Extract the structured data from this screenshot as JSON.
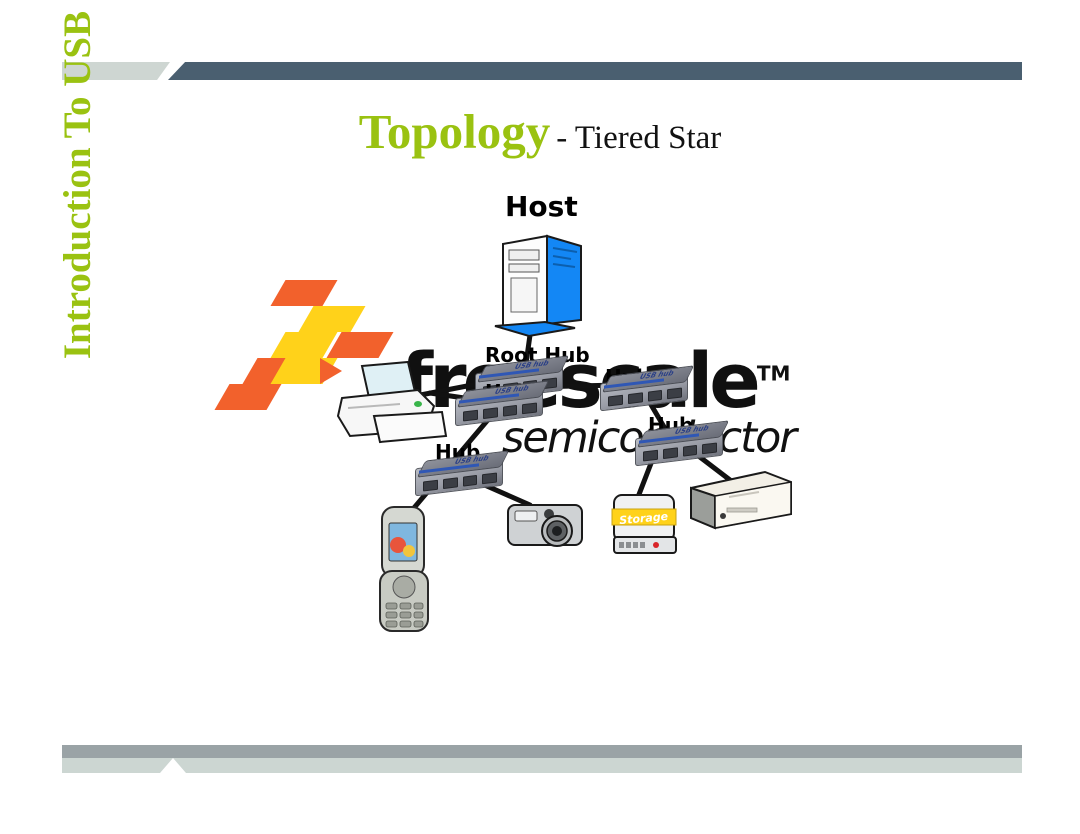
{
  "slide": {
    "title_main": "Topology",
    "title_sub": "- Tiered Star",
    "sidebar_label": "Introduction To USB"
  },
  "theme": {
    "accent_green": "#9ac211",
    "bar_dark": "#4a5f70",
    "bar_light": "#ced6d2",
    "footer_dark": "#9aa3a6",
    "footer_light": "#ccd6d2",
    "title_black": "#121212",
    "logo_orange": "#f2612c",
    "logo_yellow": "#ffd21a"
  },
  "watermark": {
    "wordmark": "freescale",
    "trademark": "TM",
    "tagline": "semiconductor"
  },
  "diagram": {
    "type": "tiered-star-topology",
    "labels": {
      "host": "Host",
      "root_hub": "Root Hub",
      "hub_a": "Hub",
      "hub_b": "Hub",
      "hub_c": "Hub",
      "hub_d": "Hub"
    },
    "devices": [
      {
        "name": "host-pc",
        "label": "Host",
        "tier": 0
      },
      {
        "name": "root-hub",
        "label": "Root Hub",
        "tier": 1
      },
      {
        "name": "hub-left",
        "label": "Hub",
        "tier": 2
      },
      {
        "name": "hub-mid",
        "label": "Hub",
        "tier": 2
      },
      {
        "name": "hub-right",
        "label": "Hub",
        "tier": 3
      },
      {
        "name": "hub-low",
        "label": "Hub",
        "tier": 3
      },
      {
        "name": "printer",
        "label": "",
        "tier": 3
      },
      {
        "name": "mobile-phone",
        "label": "",
        "tier": 4
      },
      {
        "name": "digital-camera",
        "label": "",
        "tier": 4
      },
      {
        "name": "storage-drive",
        "label": "Storage",
        "tier": 4
      },
      {
        "name": "optical-drive",
        "label": "",
        "tier": 4
      }
    ],
    "storage_label": "Storage"
  }
}
